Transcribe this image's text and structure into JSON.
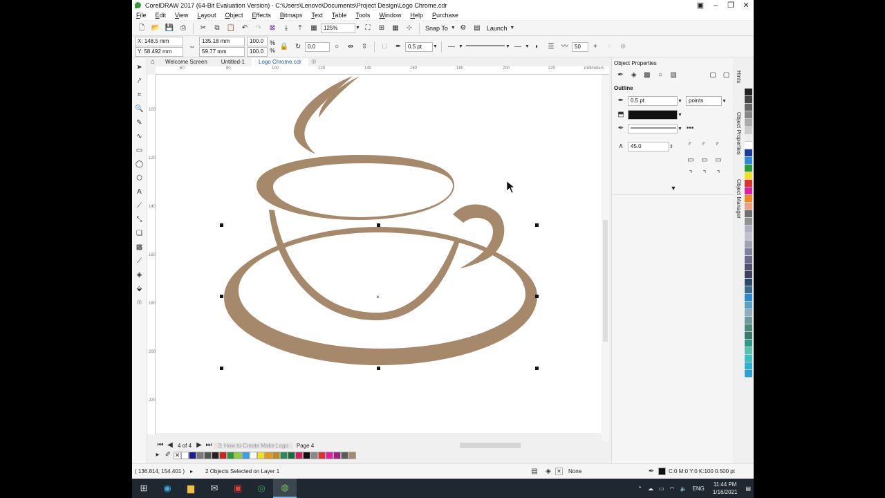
{
  "window": {
    "title": "CorelDRAW 2017 (64-Bit Evaluation Version) - C:\\Users\\Lenovo\\Documents\\Project Design\\Logo Chrome.cdr"
  },
  "menu": [
    "File",
    "Edit",
    "View",
    "Layout",
    "Object",
    "Effects",
    "Bitmaps",
    "Text",
    "Table",
    "Tools",
    "Window",
    "Help",
    "Purchase"
  ],
  "standard_toolbar": {
    "zoom": "125%",
    "snap_to": "Snap To",
    "launch": "Launch"
  },
  "property_bar": {
    "x": "148.5 mm",
    "y": "58.492 mm",
    "width": "135.18 mm",
    "height": "59.77 mm",
    "scale_w": "100.0",
    "scale_h": "100.0",
    "scale_unit": "%",
    "rotation": "0.0",
    "outline_width": "0.5 pt",
    "smoothing": "50"
  },
  "doc_tabs": [
    "Welcome Screen",
    "Untitled-1",
    "Logo Chrome.cdr"
  ],
  "ruler": {
    "top_numbers": [
      "60",
      "80",
      "100",
      "120",
      "140",
      "160",
      "180",
      "200",
      "220"
    ],
    "unit": "millimeters",
    "left_numbers": [
      "100",
      "120",
      "140",
      "160",
      "180",
      "200",
      "220"
    ]
  },
  "pages": {
    "counter": "4 of 4",
    "tab_inactive": "3: How to Create Make Logo",
    "tab_active": "Page 4"
  },
  "docker": {
    "title": "Object Properties",
    "section": "Outline",
    "width": "0.5 pt",
    "unit": "points",
    "miter": "45.0",
    "color": "#111111"
  },
  "side_tabs": [
    "Hints",
    "Object Properties",
    "Object Manager"
  ],
  "status": {
    "cursor": "( 136.814, 154.401 )",
    "selection": "2 Objects Selected on Layer 1",
    "fill": "None",
    "outline": "C:0 M:0 Y:0 K:100  0.500 pt"
  },
  "taskbar": {
    "lang": "ENG",
    "time": "11:44 PM",
    "date": "1/16/2021"
  },
  "colors": {
    "cup": "#a5896a",
    "accent": "#1a57a8"
  },
  "palette_bottom": [
    "#ffffff",
    "#1c1c8f",
    "#7a7a7a",
    "#555555",
    "#222222",
    "#cc2222",
    "#2a9a3a",
    "#8fcf3a",
    "#3aa0e0",
    "#ffffff",
    "#f0e020",
    "#e09a20",
    "#c08a20",
    "#2a8a5a",
    "#1a6a3a",
    "#d02060",
    "#101010",
    "#888888",
    "#e03030",
    "#e020a0",
    "#a02080",
    "#5a5a5a",
    "#a5896a"
  ],
  "palette_right": [
    "#222222",
    "#444444",
    "#666666",
    "#888888",
    "#aaaaaa",
    "#cccccc",
    "#eeeeee",
    "#ffffff",
    "#1a3aa0",
    "#2a8ae0",
    "#2a9a3a",
    "#f0e020",
    "#e03030",
    "#e020a0",
    "#f08a20",
    "#f0a080",
    "#707070",
    "#909090",
    "#b0b0c0",
    "#c0c0d0",
    "#a0a0b0",
    "#8080a0",
    "#6a6a8a",
    "#505070",
    "#404060",
    "#2a4a6a",
    "#3a6a8a",
    "#2a8ad0",
    "#5aa0c0",
    "#8ab0c0",
    "#6a9a9a",
    "#4a8a7a",
    "#3a7a6a",
    "#2a9a8a",
    "#5ac0b0",
    "#3ac0c0",
    "#2ab0d0",
    "#2aa0e0"
  ]
}
